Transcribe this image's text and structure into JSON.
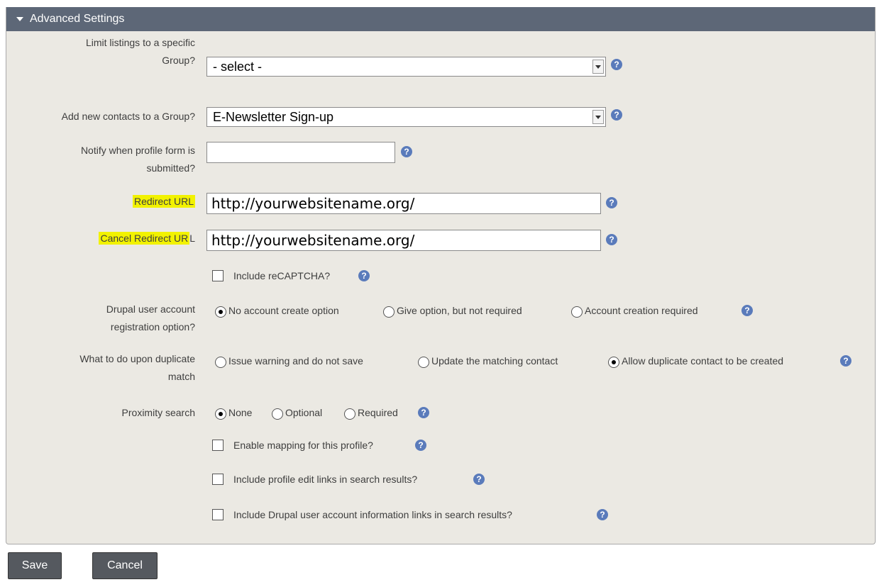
{
  "header": {
    "title": "Advanced Settings"
  },
  "fields": {
    "limit_group": {
      "label_line1": "Limit listings to a specific",
      "label_line2": "Group?",
      "value": "- select -"
    },
    "add_group": {
      "label": "Add new contacts to a Group?",
      "value": "E-Newsletter Sign-up"
    },
    "notify": {
      "label_line1": "Notify when profile form is",
      "label_line2": "submitted?",
      "value": ""
    },
    "redirect": {
      "label_hl": "Redirect URL",
      "value": "http://yourwebsitename.org/"
    },
    "cancel_redirect": {
      "label_hl": "Cancel Redirect UR",
      "label_rest": "L",
      "value": "http://yourwebsitename.org/"
    },
    "recaptcha": {
      "label": "Include reCAPTCHA?"
    },
    "drupal_reg": {
      "label_line1": "Drupal user account",
      "label_line2": "registration option?",
      "options": [
        "No account create option",
        "Give option, but not required",
        "Account creation required"
      ]
    },
    "duplicate": {
      "label_line1": "What to do upon duplicate",
      "label_line2": "match",
      "options": [
        "Issue warning and do not save",
        "Update the matching contact",
        "Allow duplicate contact to be created"
      ]
    },
    "proximity": {
      "label": "Proximity search",
      "options": [
        "None",
        "Optional",
        "Required"
      ]
    },
    "mapping": {
      "label": "Enable mapping for this profile?"
    },
    "edit_links": {
      "label": "Include profile edit links in search results?"
    },
    "drupal_links": {
      "label": "Include Drupal user account information links in search results?"
    }
  },
  "buttons": {
    "save": "Save",
    "cancel": "Cancel"
  },
  "icons": {
    "help": "?"
  },
  "colors": {
    "header_bg": "#5d6777",
    "panel_bg": "#ebe9e3",
    "highlight": "#f2f200",
    "help_icon": "#5a7bbb",
    "button_bg": "#55595f"
  }
}
